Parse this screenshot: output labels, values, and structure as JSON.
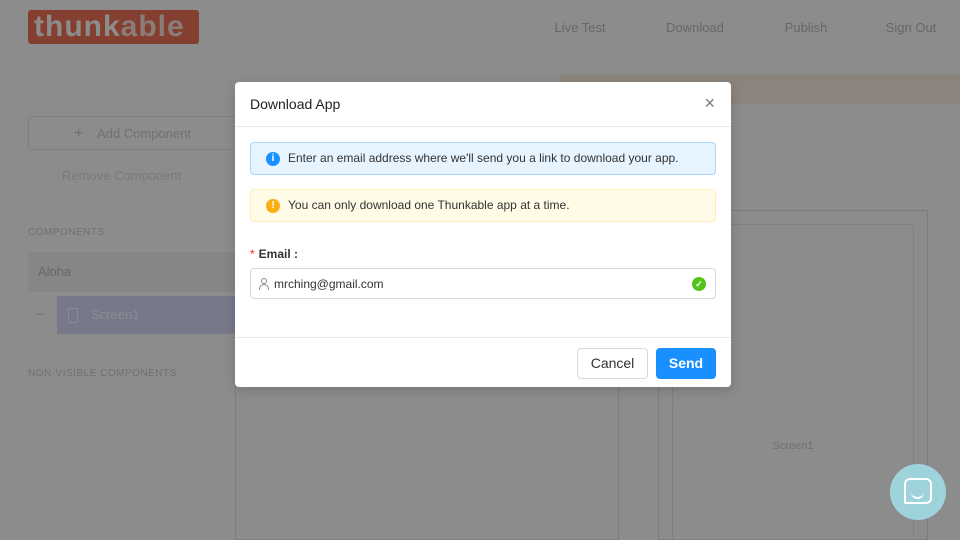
{
  "app": {
    "logo_main": "thunk",
    "logo_accent": "able",
    "nav": [
      "Live Test",
      "Download",
      "Publish",
      "Sign Out"
    ]
  },
  "sidebar": {
    "add_component": "Add Component",
    "remove_component": "Remove Component",
    "components_heading": "COMPONENTS",
    "app_name": "Aloha",
    "screen_name": "Screen1",
    "non_visible_heading": "NON-VISIBLE COMPONENTS"
  },
  "preview": {
    "screen_label": "Screen1"
  },
  "modal": {
    "title": "Download App",
    "close": "×",
    "info_text": "Enter an email address where we'll send you a link to download your app.",
    "warning_text": "You can only download one Thunkable app at a time.",
    "email_label": "Email :",
    "required_mark": "*",
    "email_value": "mrching@gmail.com",
    "cancel_label": "Cancel",
    "send_label": "Send"
  },
  "colors": {
    "brand": "#f0745a",
    "primary": "#1890ff",
    "info_bg": "#e6f4ff",
    "warning_bg": "#fffbe6",
    "success": "#52c41a"
  },
  "icons": {
    "info": "info-circle-icon",
    "warning": "exclamation-circle-icon",
    "user": "user-icon",
    "valid": "check-circle-icon",
    "close": "close-icon",
    "chat": "chat-icon"
  }
}
